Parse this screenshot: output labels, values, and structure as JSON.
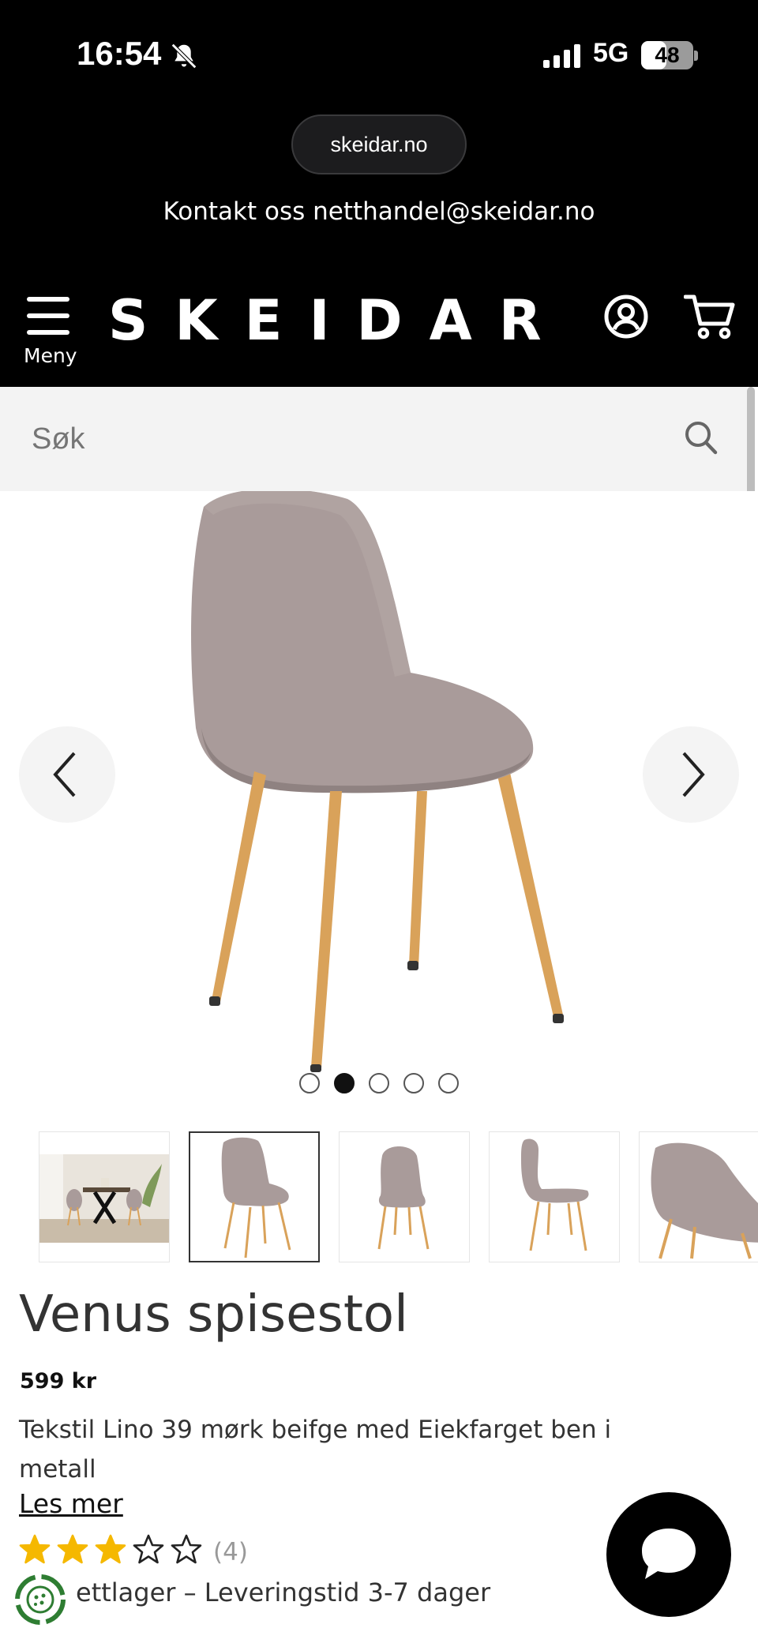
{
  "status_bar": {
    "time": "16:54",
    "network": "5G",
    "battery": "48",
    "battery_level": 0.48
  },
  "browser": {
    "url": "skeidar.no"
  },
  "topbar": {
    "contact_text": "Kontakt oss netthandel@skeidar.no"
  },
  "header": {
    "menu_label": "Meny",
    "logo": "SKEIDAR"
  },
  "search": {
    "placeholder": "Søk"
  },
  "gallery": {
    "image_count": 5,
    "active_index": 1,
    "thumbnails": [
      "room-scene",
      "chair-front-angle",
      "chair-front",
      "chair-side",
      "chair-closeup"
    ]
  },
  "product": {
    "title": "Venus spisestol",
    "price": "599 kr",
    "description": "Tekstil Lino 39 mørk beifge med Eiekfarget ben i metall",
    "read_more": "Les mer",
    "rating": 3,
    "rating_max": 5,
    "review_count": "(4)",
    "stock_text": "ettlager – Leveringstid 3-7 dager"
  },
  "colors": {
    "header_bg": "#000000",
    "search_bg": "#f3f3f3",
    "star_fill": "#f5b800",
    "fabric": "#a99b9a",
    "wood": "#d9a25a"
  }
}
